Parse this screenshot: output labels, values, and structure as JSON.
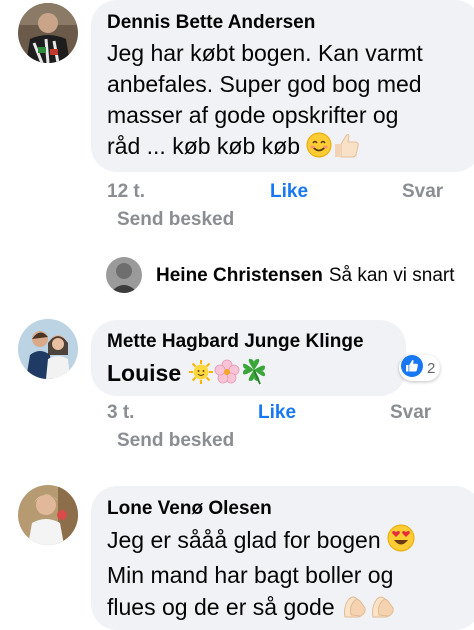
{
  "comments": [
    {
      "author": "Dennis Bette Andersen",
      "lines": [
        "Jeg har købt bogen. Kan varmt",
        "anbefales. Super god bog med",
        "masser af gode opskrifter og",
        "råd ... køb køb køb"
      ],
      "emojis": [
        "smiling-face-emoji",
        "thumbs-up-emoji"
      ],
      "time": "12 t.",
      "like": "Like",
      "reply": "Svar",
      "send": "Send besked"
    },
    {
      "author": "Mette Hagbard Junge Klinge",
      "text": "Louise",
      "emojis": [
        "sun-emoji",
        "cherry-blossom-emoji",
        "four-leaf-clover-emoji"
      ],
      "reaction_count": "2",
      "time": "3 t.",
      "like": "Like",
      "reply": "Svar",
      "send": "Send besked"
    },
    {
      "author": "Lone Venø Olesen",
      "lines": [
        "Jeg er sååå glad for bogen",
        "Min mand har bagt boller og",
        "flues og de er så gode"
      ],
      "emojis": [
        "heart-eyes-emoji",
        "clapping-hands-emoji"
      ]
    }
  ],
  "reply_preview": {
    "name": "Heine Christensen",
    "text": "Så kan vi snart"
  },
  "colors": {
    "bubble": "#f0f2f5",
    "link": "#1877f2",
    "meta": "#8a8d91"
  }
}
